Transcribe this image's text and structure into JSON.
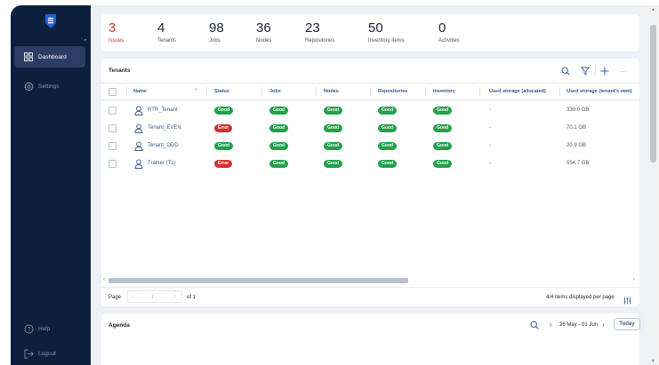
{
  "brand": {
    "color": "#1f63d8"
  },
  "sidebar": {
    "nav": [
      {
        "label": "Dashboard",
        "icon": "dashboard-grid-icon",
        "active": true
      },
      {
        "label": "Settings",
        "icon": "gear-icon",
        "active": false
      }
    ],
    "footer": [
      {
        "label": "Help",
        "icon": "help-circle-icon"
      },
      {
        "label": "Logout",
        "icon": "logout-icon"
      }
    ]
  },
  "stats": [
    {
      "value": "3",
      "label": "Issues",
      "alert": true
    },
    {
      "value": "4",
      "label": "Tenants"
    },
    {
      "value": "98",
      "label": "Jobs"
    },
    {
      "value": "36",
      "label": "Nodes"
    },
    {
      "value": "23",
      "label": "Repositories"
    },
    {
      "value": "50",
      "label": "Inventory items"
    },
    {
      "value": "0",
      "label": "Activities"
    }
  ],
  "tenants": {
    "title": "Tenants",
    "columns": [
      "Name",
      "Status",
      "Jobs",
      "Nodes",
      "Repositories",
      "Inventory",
      "Used storage (allocated)",
      "Used storage (tenant's own)"
    ],
    "rows": [
      {
        "name": "RTR_Tenant",
        "status": "Good",
        "jobs": "Good",
        "nodes": "Good",
        "repositories": "Good",
        "inventory": "Good",
        "allocated": "-",
        "own": "339.0 GB"
      },
      {
        "name": "Tenant_EVEN",
        "status": "Error",
        "jobs": "Good",
        "nodes": "Good",
        "repositories": "Good",
        "inventory": "Good",
        "allocated": "-",
        "own": "70.1 GB"
      },
      {
        "name": "Tenant_ODD",
        "status": "Good",
        "jobs": "Good",
        "nodes": "Good",
        "repositories": "Good",
        "inventory": "Good",
        "allocated": "-",
        "own": "20.9 GB"
      },
      {
        "name": "Trainer (T1)",
        "status": "Error",
        "jobs": "Good",
        "nodes": "Good",
        "repositories": "Good",
        "inventory": "Good",
        "allocated": "-",
        "own": "554.7 GB"
      }
    ],
    "pager": {
      "page_label": "Page",
      "page": "1",
      "of_label": "of 1",
      "summary": "4/4 items displayed per page"
    }
  },
  "agenda": {
    "title": "Agenda",
    "range": "26 May - 01 Jun",
    "today_label": "Today"
  },
  "colors": {
    "good": "#1fa24a",
    "error": "#d62f2f",
    "sidebar": "#0c1f3c",
    "link": "#355a8a"
  }
}
